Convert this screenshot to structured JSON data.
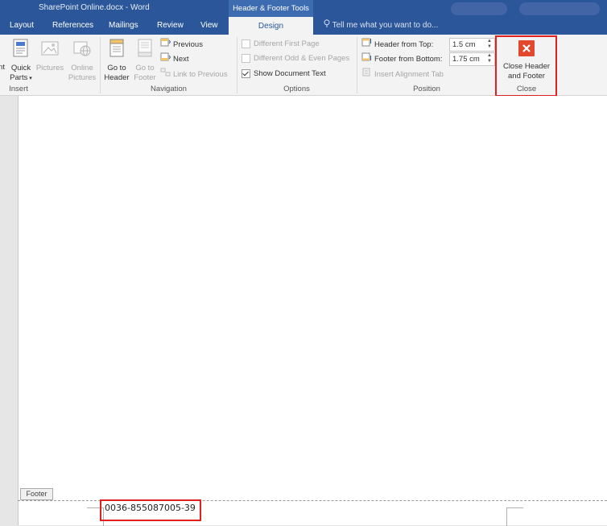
{
  "window": {
    "doc_title": "SharePoint Online.docx - Word",
    "contextual_tab_group": "Header & Footer Tools"
  },
  "tabs": [
    {
      "label": "Layout"
    },
    {
      "label": "References"
    },
    {
      "label": "Mailings"
    },
    {
      "label": "Review"
    },
    {
      "label": "View"
    },
    {
      "label": "Design"
    }
  ],
  "tell_me": "Tell me what you want to do...",
  "ribbon": {
    "insert": {
      "partial_label": "nt",
      "quick_parts": "Quick",
      "quick_parts_line2": "Parts",
      "pictures": "Pictures",
      "online_pictures": "Online",
      "online_pictures_line2": "Pictures",
      "group_label": "Insert"
    },
    "navigation": {
      "go_to_header": "Go to",
      "go_to_header_line2": "Header",
      "go_to_footer": "Go to",
      "go_to_footer_line2": "Footer",
      "previous": "Previous",
      "next": "Next",
      "link_to_previous": "Link to Previous",
      "group_label": "Navigation"
    },
    "options": {
      "different_first_page": "Different First Page",
      "different_odd_even": "Different Odd & Even Pages",
      "show_document_text": "Show Document Text",
      "group_label": "Options"
    },
    "position": {
      "header_from_top_label": "Header from Top:",
      "header_from_top_value": "1.5 cm",
      "footer_from_bottom_label": "Footer from Bottom:",
      "footer_from_bottom_value": "1.75 cm",
      "insert_alignment_tab": "Insert Alignment Tab",
      "group_label": "Position"
    },
    "close": {
      "close_button": "Close Header",
      "close_button_line2": "and Footer",
      "group_label": "Close"
    }
  },
  "document": {
    "footer_tag": "Footer",
    "footer_text": "0036-855087005-39"
  },
  "colors": {
    "title_bar": "#2b579a",
    "close_icon": "#e0492d",
    "highlight": "#e0211f"
  }
}
